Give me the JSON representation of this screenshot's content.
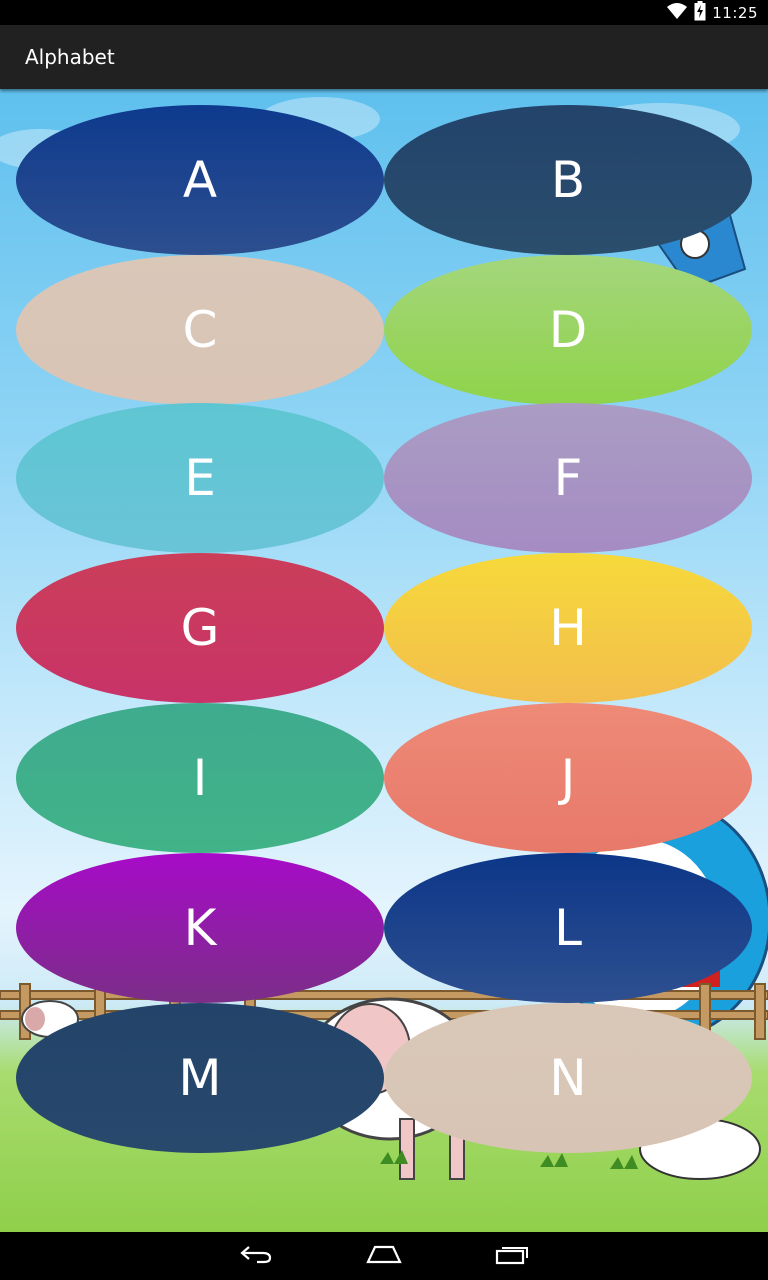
{
  "status_bar": {
    "time": "11:25",
    "icons": [
      "wifi-icon",
      "battery-charging-icon"
    ]
  },
  "action_bar": {
    "title": "Alphabet"
  },
  "letters": [
    {
      "label": "A",
      "color_top": "#0e3a8e",
      "color_bottom": "#2d4f8f"
    },
    {
      "label": "B",
      "color_top": "#23436b",
      "color_bottom": "#2a4e6c"
    },
    {
      "label": "C",
      "color_top": "#d9c7b8",
      "color_bottom": "#d9c4b5"
    },
    {
      "label": "D",
      "color_top": "#a4d67c",
      "color_bottom": "#8fd34a"
    },
    {
      "label": "E",
      "color_top": "#5ec6d2",
      "color_bottom": "#6ac4d8"
    },
    {
      "label": "F",
      "color_top": "#aa9cc3",
      "color_bottom": "#a58cc3"
    },
    {
      "label": "G",
      "color_top": "#cb3e59",
      "color_bottom": "#c83368"
    },
    {
      "label": "H",
      "color_top": "#f6d93a",
      "color_bottom": "#f3be4d"
    },
    {
      "label": "I",
      "color_top": "#3fab8e",
      "color_bottom": "#41b388"
    },
    {
      "label": "J",
      "color_top": "#ee8a77",
      "color_bottom": "#e8796a"
    },
    {
      "label": "K",
      "color_top": "#a70bc8",
      "color_bottom": "#7b2e88"
    },
    {
      "label": "L",
      "color_top": "#0c3688",
      "color_bottom": "#2e5090"
    },
    {
      "label": "M",
      "color_top": "#23436a",
      "color_bottom": "#28496c"
    },
    {
      "label": "N",
      "color_top": "#d9c8b8",
      "color_bottom": "#d8c4b4"
    }
  ],
  "nav_bar": {
    "buttons": [
      "back-icon",
      "home-icon",
      "recent-apps-icon"
    ]
  }
}
